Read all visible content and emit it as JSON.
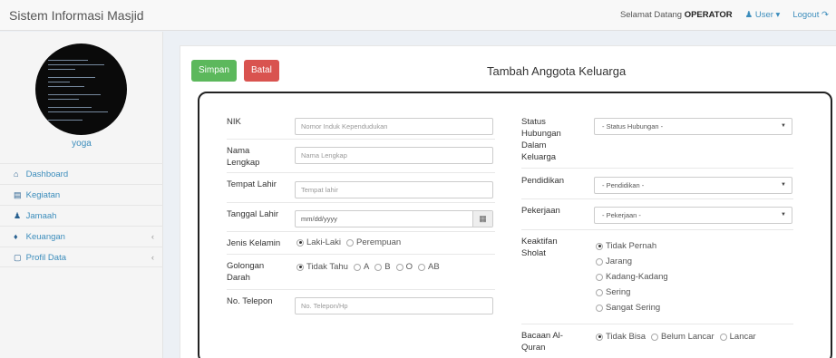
{
  "app": {
    "title": "Sistem Informasi Masjid"
  },
  "topnav": {
    "greeting": "Selamat Datang",
    "username": "OPERATOR",
    "user_menu": "User",
    "logout": "Logout"
  },
  "sidebar": {
    "username": "yoga",
    "items": [
      {
        "label": "Dashboard",
        "icon": "home-icon"
      },
      {
        "label": "Kegiatan",
        "icon": "calendar-icon"
      },
      {
        "label": "Jamaah",
        "icon": "users-icon"
      },
      {
        "label": "Keuangan",
        "icon": "money-icon"
      },
      {
        "label": "Profil Data",
        "icon": "file-icon"
      }
    ]
  },
  "toolbar": {
    "save_label": "Simpan",
    "cancel_label": "Batal"
  },
  "form": {
    "title": "Tambah Anggota Keluarga",
    "nik": {
      "label": "NIK",
      "placeholder": "Nomor Induk Kependudukan"
    },
    "nama": {
      "label": "Nama Lengkap",
      "placeholder": "Nama Lengkap"
    },
    "tempat_lahir": {
      "label": "Tempat Lahir",
      "placeholder": "Tempat lahir"
    },
    "tanggal_lahir": {
      "label": "Tanggal Lahir",
      "value": "mm/dd/yyyy"
    },
    "jenis_kelamin": {
      "label": "Jenis Kelamin",
      "options": [
        "Laki-Laki",
        "Perempuan"
      ],
      "selected": "Laki-Laki"
    },
    "golongan_darah": {
      "label": "Golongan Darah",
      "options": [
        "Tidak Tahu",
        "A",
        "B",
        "O",
        "AB"
      ],
      "selected": "Tidak Tahu"
    },
    "telepon": {
      "label": "No. Telepon",
      "placeholder": "No. Telepon/Hp"
    },
    "status_hubungan": {
      "label": "Status Hubungan Dalam Keluarga",
      "value": "- Status Hubungan -"
    },
    "pendidikan": {
      "label": "Pendidikan",
      "value": "- Pendidikan -"
    },
    "pekerjaan": {
      "label": "Pekerjaan",
      "value": "- Pekerjaan -"
    },
    "keaktifan": {
      "label": "Keaktifan Sholat",
      "options": [
        "Tidak Pernah",
        "Jarang",
        "Kadang-Kadang",
        "Sering",
        "Sangat Sering"
      ],
      "selected": "Tidak Pernah"
    },
    "bacaan": {
      "label": "Bacaan Al-Quran",
      "options": [
        "Tidak Bisa",
        "Belum Lancar",
        "Lancar"
      ],
      "selected": "Tidak Bisa"
    }
  }
}
